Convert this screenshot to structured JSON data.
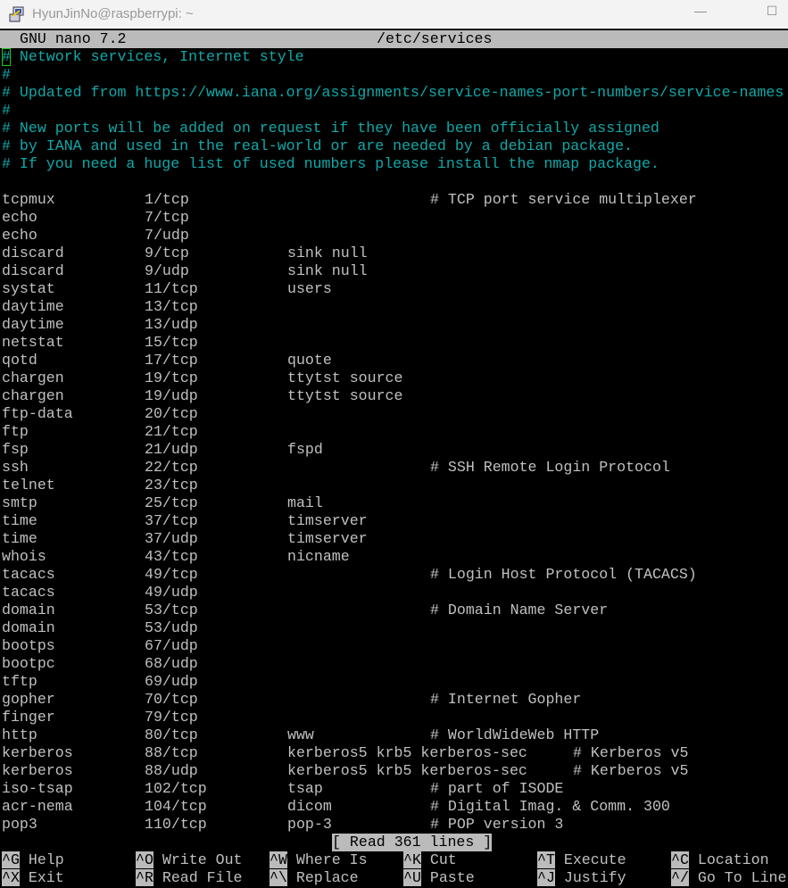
{
  "window": {
    "title": "HyunJinNo@raspberrypi: ~",
    "minimize_icon": "minimize-icon",
    "maximize_icon": "maximize-icon"
  },
  "nano": {
    "version": "GNU nano 7.2",
    "filename": "/etc/services"
  },
  "colors": {
    "header_bg": "#bbbbbb",
    "comment": "#11a8a8",
    "text": "#c0c0c0",
    "cursor": "#16d016"
  },
  "comments": [
    "# Network services, Internet style",
    "#",
    "# Updated from https://www.iana.org/assignments/service-names-port-numbers/service-names",
    "#",
    "# New ports will be added on request if they have been officially assigned",
    "# by IANA and used in the real-world or are needed by a debian package.",
    "# If you need a huge list of used numbers please install the nmap package.",
    ""
  ],
  "services": [
    {
      "name": "tcpmux",
      "port": "1/tcp",
      "aliases": "",
      "comment": "# TCP port service multiplexer"
    },
    {
      "name": "echo",
      "port": "7/tcp",
      "aliases": "",
      "comment": ""
    },
    {
      "name": "echo",
      "port": "7/udp",
      "aliases": "",
      "comment": ""
    },
    {
      "name": "discard",
      "port": "9/tcp",
      "aliases": "sink null",
      "comment": ""
    },
    {
      "name": "discard",
      "port": "9/udp",
      "aliases": "sink null",
      "comment": ""
    },
    {
      "name": "systat",
      "port": "11/tcp",
      "aliases": "users",
      "comment": ""
    },
    {
      "name": "daytime",
      "port": "13/tcp",
      "aliases": "",
      "comment": ""
    },
    {
      "name": "daytime",
      "port": "13/udp",
      "aliases": "",
      "comment": ""
    },
    {
      "name": "netstat",
      "port": "15/tcp",
      "aliases": "",
      "comment": ""
    },
    {
      "name": "qotd",
      "port": "17/tcp",
      "aliases": "quote",
      "comment": ""
    },
    {
      "name": "chargen",
      "port": "19/tcp",
      "aliases": "ttytst source",
      "comment": ""
    },
    {
      "name": "chargen",
      "port": "19/udp",
      "aliases": "ttytst source",
      "comment": ""
    },
    {
      "name": "ftp-data",
      "port": "20/tcp",
      "aliases": "",
      "comment": ""
    },
    {
      "name": "ftp",
      "port": "21/tcp",
      "aliases": "",
      "comment": ""
    },
    {
      "name": "fsp",
      "port": "21/udp",
      "aliases": "fspd",
      "comment": ""
    },
    {
      "name": "ssh",
      "port": "22/tcp",
      "aliases": "",
      "comment": "# SSH Remote Login Protocol"
    },
    {
      "name": "telnet",
      "port": "23/tcp",
      "aliases": "",
      "comment": ""
    },
    {
      "name": "smtp",
      "port": "25/tcp",
      "aliases": "mail",
      "comment": ""
    },
    {
      "name": "time",
      "port": "37/tcp",
      "aliases": "timserver",
      "comment": ""
    },
    {
      "name": "time",
      "port": "37/udp",
      "aliases": "timserver",
      "comment": ""
    },
    {
      "name": "whois",
      "port": "43/tcp",
      "aliases": "nicname",
      "comment": ""
    },
    {
      "name": "tacacs",
      "port": "49/tcp",
      "aliases": "",
      "comment": "# Login Host Protocol (TACACS)"
    },
    {
      "name": "tacacs",
      "port": "49/udp",
      "aliases": "",
      "comment": ""
    },
    {
      "name": "domain",
      "port": "53/tcp",
      "aliases": "",
      "comment": "# Domain Name Server"
    },
    {
      "name": "domain",
      "port": "53/udp",
      "aliases": "",
      "comment": ""
    },
    {
      "name": "bootps",
      "port": "67/udp",
      "aliases": "",
      "comment": ""
    },
    {
      "name": "bootpc",
      "port": "68/udp",
      "aliases": "",
      "comment": ""
    },
    {
      "name": "tftp",
      "port": "69/udp",
      "aliases": "",
      "comment": ""
    },
    {
      "name": "gopher",
      "port": "70/tcp",
      "aliases": "",
      "comment": "# Internet Gopher"
    },
    {
      "name": "finger",
      "port": "79/tcp",
      "aliases": "",
      "comment": ""
    },
    {
      "name": "http",
      "port": "80/tcp",
      "aliases": "www",
      "comment": "# WorldWideWeb HTTP"
    },
    {
      "name": "kerberos",
      "port": "88/tcp",
      "aliases": "kerberos5 krb5 kerberos-sec",
      "comment": "# Kerberos v5"
    },
    {
      "name": "kerberos",
      "port": "88/udp",
      "aliases": "kerberos5 krb5 kerberos-sec",
      "comment": "# Kerberos v5"
    },
    {
      "name": "iso-tsap",
      "port": "102/tcp",
      "aliases": "tsap",
      "comment": "# part of ISODE"
    },
    {
      "name": "acr-nema",
      "port": "104/tcp",
      "aliases": "dicom",
      "comment": "# Digital Imag. & Comm. 300"
    },
    {
      "name": "pop3",
      "port": "110/tcp",
      "aliases": "pop-3",
      "comment": "# POP version 3"
    }
  ],
  "status": "[ Read 361 lines ]",
  "shortcuts": [
    [
      {
        "key": "^G",
        "label": "Help"
      },
      {
        "key": "^O",
        "label": "Write Out"
      },
      {
        "key": "^W",
        "label": "Where Is"
      },
      {
        "key": "^K",
        "label": "Cut"
      },
      {
        "key": "^T",
        "label": "Execute"
      },
      {
        "key": "^C",
        "label": "Location"
      }
    ],
    [
      {
        "key": "^X",
        "label": "Exit"
      },
      {
        "key": "^R",
        "label": "Read File"
      },
      {
        "key": "^\\",
        "label": "Replace"
      },
      {
        "key": "^U",
        "label": "Paste"
      },
      {
        "key": "^J",
        "label": "Justify"
      },
      {
        "key": "^/",
        "label": "Go To Line"
      }
    ]
  ]
}
